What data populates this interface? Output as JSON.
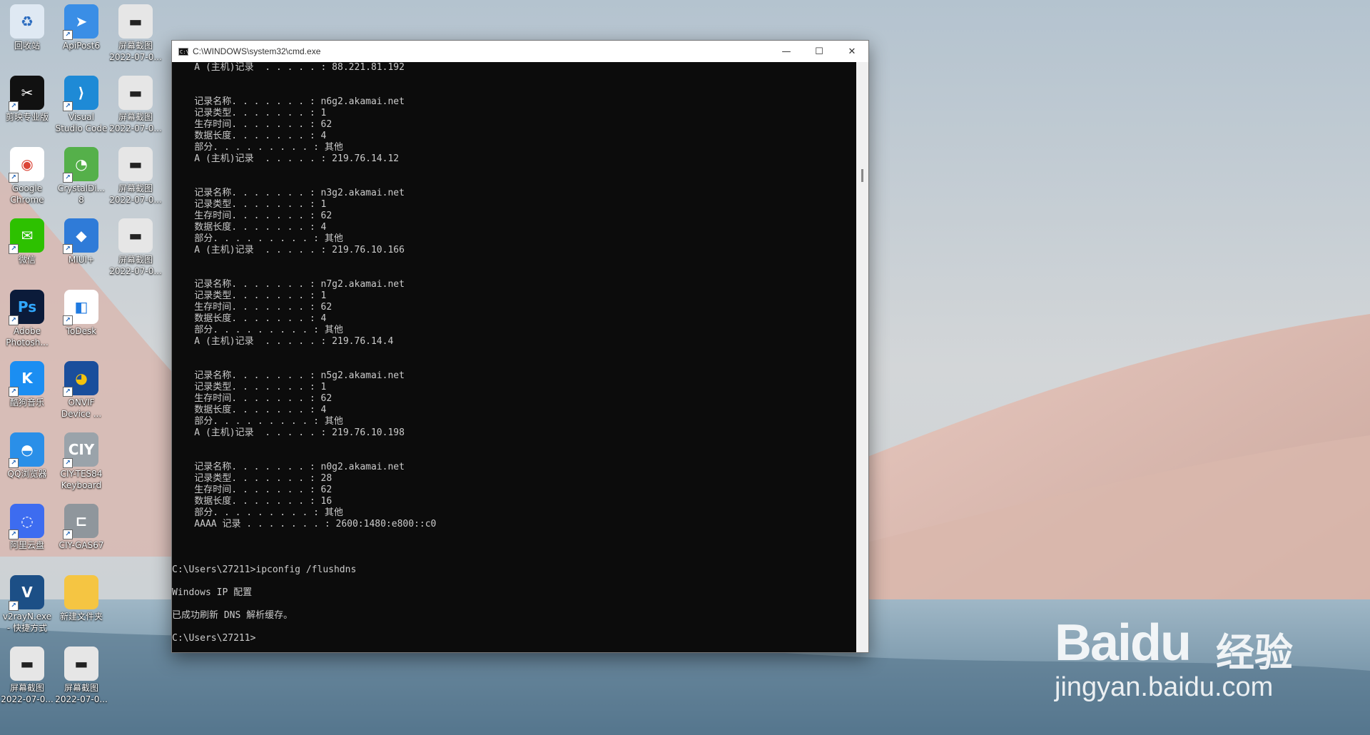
{
  "window": {
    "title": "C:\\WINDOWS\\system32\\cmd.exe",
    "minimize": "—",
    "maximize": "☐",
    "close": "✕"
  },
  "console_lines": [
    "    A (主机)记录  . . . . . : 88.221.81.192",
    "",
    "",
    "    记录名称. . . . . . . : n6g2.akamai.net",
    "    记录类型. . . . . . . : 1",
    "    生存时间. . . . . . . : 62",
    "    数据长度. . . . . . . : 4",
    "    部分. . . . . . . . . : 其他",
    "    A (主机)记录  . . . . . : 219.76.14.12",
    "",
    "",
    "    记录名称. . . . . . . : n3g2.akamai.net",
    "    记录类型. . . . . . . : 1",
    "    生存时间. . . . . . . : 62",
    "    数据长度. . . . . . . : 4",
    "    部分. . . . . . . . . : 其他",
    "    A (主机)记录  . . . . . : 219.76.10.166",
    "",
    "",
    "    记录名称. . . . . . . : n7g2.akamai.net",
    "    记录类型. . . . . . . : 1",
    "    生存时间. . . . . . . : 62",
    "    数据长度. . . . . . . : 4",
    "    部分. . . . . . . . . : 其他",
    "    A (主机)记录  . . . . . : 219.76.14.4",
    "",
    "",
    "    记录名称. . . . . . . : n5g2.akamai.net",
    "    记录类型. . . . . . . : 1",
    "    生存时间. . . . . . . : 62",
    "    数据长度. . . . . . . : 4",
    "    部分. . . . . . . . . : 其他",
    "    A (主机)记录  . . . . . : 219.76.10.198",
    "",
    "",
    "    记录名称. . . . . . . : n0g2.akamai.net",
    "    记录类型. . . . . . . : 28",
    "    生存时间. . . . . . . : 62",
    "    数据长度. . . . . . . : 16",
    "    部分. . . . . . . . . : 其他",
    "    AAAA 记录 . . . . . . . : 2600:1480:e800::c0",
    "",
    "",
    "",
    "C:\\Users\\27211>ipconfig /flushdns",
    "",
    "Windows IP 配置",
    "",
    "已成功刷新 DNS 解析缓存。",
    "",
    "C:\\Users\\27211>"
  ],
  "desktop_icons": [
    {
      "name": "recycle-bin-icon",
      "label": "回收站",
      "color": "#dfe9f3",
      "glyph": "♻",
      "fg": "#2a6bbf",
      "shortcut": false
    },
    {
      "name": "apipost-icon",
      "label": "ApiPost6",
      "color": "#3a8ee6",
      "glyph": "➤",
      "fg": "#ffffff",
      "shortcut": true
    },
    {
      "name": "screenshot-icon",
      "label": "屏幕截图\n2022-07-0...",
      "color": "#e6e6e6",
      "glyph": "▬",
      "fg": "#222222",
      "shortcut": false
    },
    {
      "name": "capcut-icon",
      "label": "剪映专业版",
      "color": "#111111",
      "glyph": "✂",
      "fg": "#ffffff",
      "shortcut": true
    },
    {
      "name": "vscode-icon",
      "label": "Visual\nStudio Code",
      "color": "#1e8ad6",
      "glyph": "⟩",
      "fg": "#ffffff",
      "shortcut": true
    },
    {
      "name": "screenshot-icon",
      "label": "屏幕截图\n2022-07-0...",
      "color": "#e6e6e6",
      "glyph": "▬",
      "fg": "#222222",
      "shortcut": false
    },
    {
      "name": "chrome-icon",
      "label": "Google\nChrome",
      "color": "#ffffff",
      "glyph": "◉",
      "fg": "#db4437",
      "shortcut": true
    },
    {
      "name": "crystaldiskinfo-icon",
      "label": "CrystalDi...\n8",
      "color": "#55b04a",
      "glyph": "◔",
      "fg": "#ffffff",
      "shortcut": true
    },
    {
      "name": "screenshot-icon",
      "label": "屏幕截图\n2022-07-0...",
      "color": "#e6e6e6",
      "glyph": "▬",
      "fg": "#222222",
      "shortcut": false
    },
    {
      "name": "wechat-icon",
      "label": "微信",
      "color": "#2dc100",
      "glyph": "✉",
      "fg": "#ffffff",
      "shortcut": true
    },
    {
      "name": "miui-icon",
      "label": "MIUI+",
      "color": "#2f7bd8",
      "glyph": "◆",
      "fg": "#ffffff",
      "shortcut": true
    },
    {
      "name": "screenshot-icon",
      "label": "屏幕截图\n2022-07-0...",
      "color": "#e6e6e6",
      "glyph": "▬",
      "fg": "#222222",
      "shortcut": false
    },
    {
      "name": "photoshop-icon",
      "label": "Adobe\nPhotosh...",
      "color": "#0b1b3a",
      "glyph": "Ps",
      "fg": "#31a8ff",
      "shortcut": true
    },
    {
      "name": "todesk-icon",
      "label": "ToDesk",
      "color": "#ffffff",
      "glyph": "◧",
      "fg": "#1f7ae0",
      "shortcut": true
    },
    {
      "name": "kugou-icon",
      "label": "酷狗音乐",
      "color": "#1b8ef2",
      "glyph": "K",
      "fg": "#ffffff",
      "shortcut": true
    },
    {
      "name": "onvif-icon",
      "label": "ONVIF\nDevice ...",
      "color": "#1a4e9c",
      "glyph": "◕",
      "fg": "#f4c20d",
      "shortcut": true
    },
    {
      "name": "qq-browser-icon",
      "label": "QQ浏览器",
      "color": "#2a8fe8",
      "glyph": "◓",
      "fg": "#ffffff",
      "shortcut": true
    },
    {
      "name": "civ-keyboard-icon",
      "label": "CIY-TES84\nKeyboard",
      "color": "#9aa3aa",
      "glyph": "CIY",
      "fg": "#ffffff",
      "shortcut": true
    },
    {
      "name": "aliyun-drive-icon",
      "label": "阿里云盘",
      "color": "#3d6cf0",
      "glyph": "◌",
      "fg": "#ffffff",
      "shortcut": true
    },
    {
      "name": "civ-gas67-icon",
      "label": "CIY-GAS67",
      "color": "#8f969c",
      "glyph": "⊏",
      "fg": "#ffffff",
      "shortcut": true
    },
    {
      "name": "v2rayn-icon",
      "label": "v2rayN.exe\n- 快捷方式",
      "color": "#1c4f86",
      "glyph": "V",
      "fg": "#ffffff",
      "shortcut": true
    },
    {
      "name": "folder-icon",
      "label": "新建文件夹",
      "color": "#f5c542",
      "glyph": "",
      "fg": "#ffffff",
      "shortcut": false
    },
    {
      "name": "screenshot-icon",
      "label": "屏幕截图\n2022-07-0...",
      "color": "#e6e6e6",
      "glyph": "▬",
      "fg": "#222222",
      "shortcut": false
    },
    {
      "name": "screenshot-icon",
      "label": "屏幕截图\n2022-07-0...",
      "color": "#e6e6e6",
      "glyph": "▬",
      "fg": "#222222",
      "shortcut": false
    }
  ],
  "watermark": {
    "brand": "Bai",
    "brand2": "du",
    "product": "经验",
    "url": "jingyan.baidu.com"
  }
}
